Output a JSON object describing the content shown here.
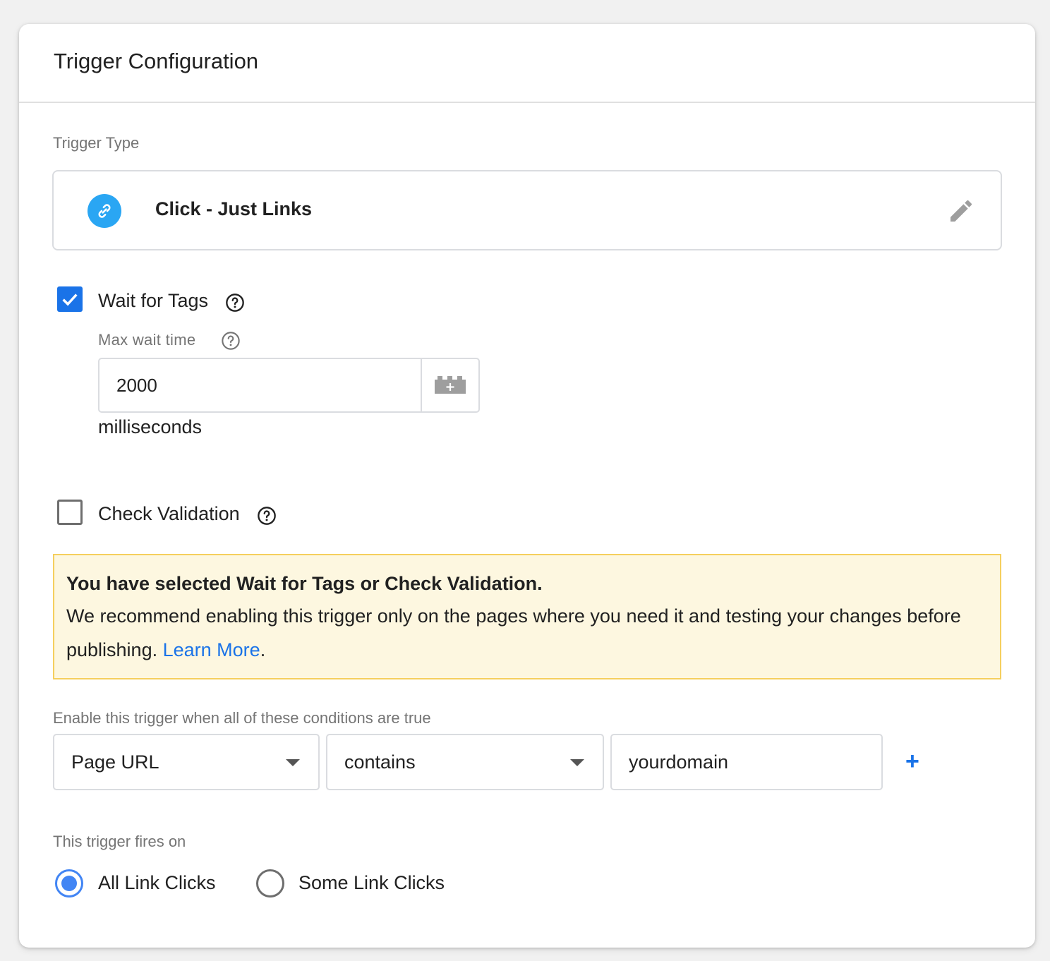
{
  "card": {
    "title": "Trigger Configuration"
  },
  "trigger_type": {
    "section_label": "Trigger Type",
    "name": "Click - Just Links",
    "icon": "link-icon",
    "icon_color": "#2aa6f3"
  },
  "wait_for_tags": {
    "label": "Wait for Tags",
    "checked": true,
    "max_wait_label": "Max wait time",
    "max_wait_value": "2000",
    "unit": "milliseconds"
  },
  "check_validation": {
    "label": "Check Validation",
    "checked": false
  },
  "warning": {
    "title": "You have selected Wait for Tags or Check Validation.",
    "text": "We recommend enabling this trigger only on the pages where you need it and testing your changes before publishing.",
    "link_text": "Learn More",
    "trailing": "."
  },
  "conditions": {
    "label": "Enable this trigger when all of these conditions are true",
    "variable": "Page URL",
    "operator": "contains",
    "value": "yourdomain",
    "add_label": "+"
  },
  "fires_on": {
    "label": "This trigger fires on",
    "options": [
      "All Link Clicks",
      "Some Link Clicks"
    ],
    "selected": "All Link Clicks"
  },
  "colors": {
    "accent": "#1a73e8",
    "warning_bg": "#fdf7e0",
    "warning_border": "#f5cf5e"
  }
}
